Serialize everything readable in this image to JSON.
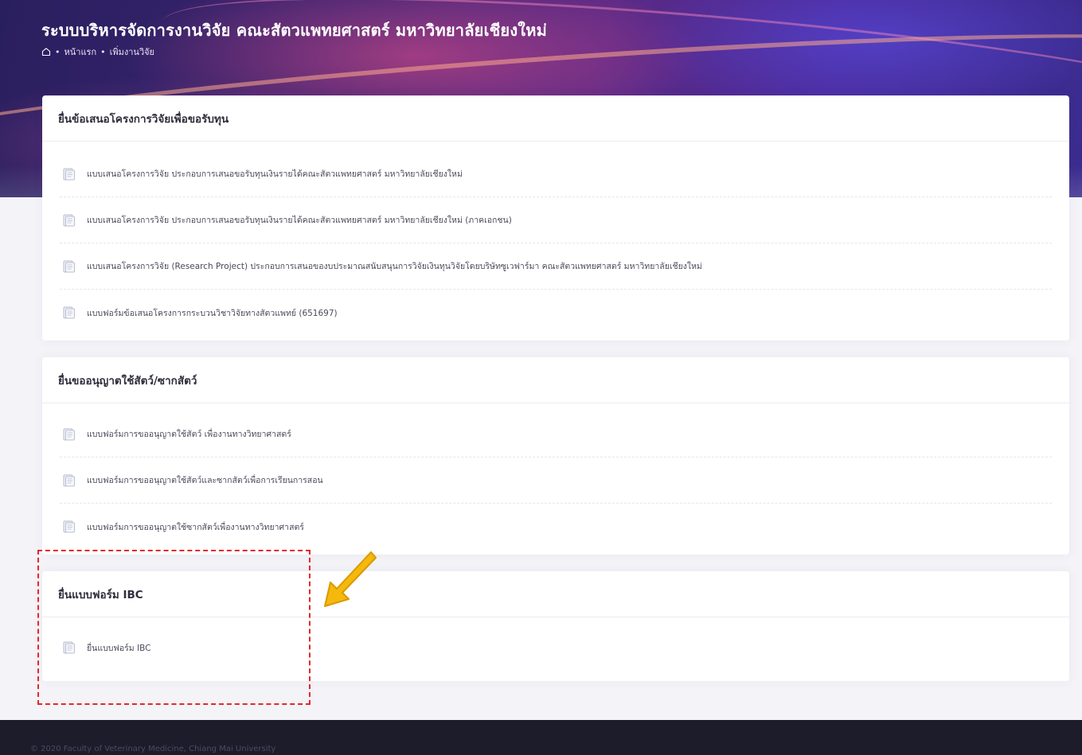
{
  "header": {
    "title": "ระบบบริหารจัดการงานวิจัย คณะสัตวแพทยศาสตร์ มหาวิทยาลัยเชียงใหม่",
    "breadcrumb": {
      "home_icon": "home-icon",
      "items": [
        "หน้าแรก",
        "เพิ่มงานวิจัย"
      ]
    }
  },
  "sections": [
    {
      "title": "ยื่นข้อเสนอโครงการวิจัยเพื่อขอรับทุน",
      "items": [
        "แบบเสนอโครงการวิจัย ประกอบการเสนอขอรับทุนเงินรายได้คณะสัตวแพทยศาสตร์ มหาวิทยาลัยเชียงใหม่",
        "แบบเสนอโครงการวิจัย ประกอบการเสนอขอรับทุนเงินรายได้คณะสัตวแพทยศาสตร์ มหาวิทยาลัยเชียงใหม่ (ภาคเอกชน)",
        "แบบเสนอโครงการวิจัย (Research Project) ประกอบการเสนอของบประมาณสนับสนุนการวิจัยเงินทุนวิจัยโดยบริษัทซูเวฟาร์มา คณะสัตวแพทยศาสตร์ มหาวิทยาลัยเชียงใหม่",
        "แบบฟอร์มข้อเสนอโครงการกระบวนวิชาวิจัยทางสัตวแพทย์ (651697)"
      ]
    },
    {
      "title": "ยื่นขออนุญาตใช้สัตว์/ซากสัตว์",
      "items": [
        "แบบฟอร์มการขออนุญาตใช้สัตว์ เพื่องานทางวิทยาศาสตร์",
        "แบบฟอร์มการขออนุญาตใช้สัตว์และซากสัตว์เพื่อการเรียนการสอน",
        "แบบฟอร์มการขออนุญาตใช้ซากสัตว์เพื่องานทางวิทยาศาสตร์"
      ]
    },
    {
      "title": "ยื่นแบบฟอร์ม IBC",
      "items": [
        "ยื่นแบบฟอร์ม IBC"
      ]
    }
  ],
  "item_icon": "document-icon",
  "annotation": {
    "box_color": "#e8262a",
    "arrow_color": "#f5b80c"
  },
  "footer": {
    "text": "© 2020 Faculty of Veterinary Medicine, Chiang Mai University"
  },
  "colors": {
    "hero_start": "#2a1f5e",
    "hero_mid": "#5a2a86",
    "hero_end": "#3a2c8e",
    "footer_bg": "#1c1c2a",
    "page_bg": "#f3f3f8"
  }
}
